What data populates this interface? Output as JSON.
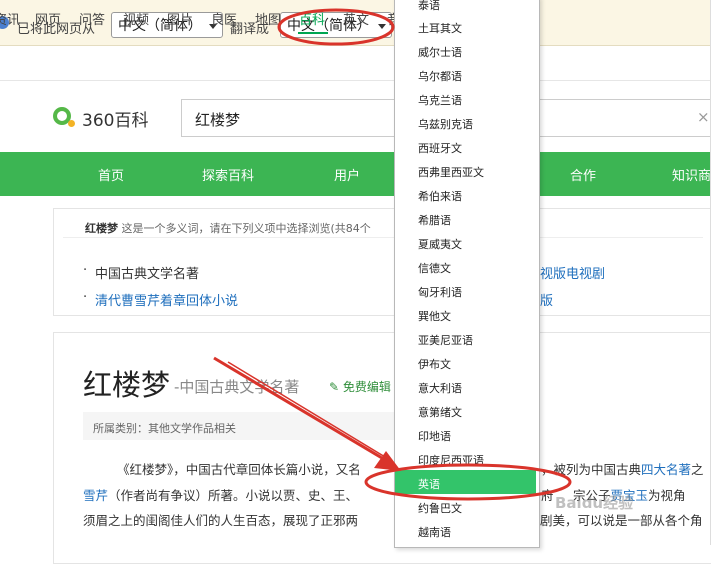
{
  "translate_bar": {
    "prefix": "已将此网页从",
    "from_lang": "中文（简体）",
    "middle": "翻译成",
    "to_lang": "中文（简体）"
  },
  "nav": {
    "items": [
      "资讯",
      "网页",
      "问答",
      "视频",
      "图片",
      "良医",
      "地图",
      "百科",
      "英文",
      "音"
    ],
    "active": "百科"
  },
  "header": {
    "logo": "360百科",
    "search_value": "红楼梦",
    "clear_glyph": "×"
  },
  "menu": {
    "items": [
      "首页",
      "探索百科",
      "用户",
      "合作",
      "知识商"
    ]
  },
  "disambiguation": {
    "term": "红楼梦",
    "note": "这是一个多义词，请在下列义项中选择浏览(共84个",
    "left_options": [
      "中国古典文学名著",
      "清代曹雪芹着章回体小说"
    ],
    "right_options": [
      "视版电视剧",
      "版"
    ]
  },
  "article": {
    "title": "红楼梦",
    "subtitle": "-中国古典文学名著",
    "edit_label": "免费编辑",
    "category_label": "所属类别：",
    "category_value": "其他文学作品相关",
    "line1_a": "《红楼梦》，中国古代章回体长篇小说，又名",
    "line1_b": "，被列为中国古典",
    "line1_link": "四大名著",
    "line1_c": "之",
    "line2_link": "雪芹",
    "line2_a": "（作者尚有争议）所著。小说以贾、史、王、",
    "line2_b": "府",
    "line2_c": "宗",
    "line2_d": "公子",
    "line2_link2": "贾宝玉",
    "line2_e": "为视角",
    "line3_a": "须眉之上的闺阁佳人们的人生百态，展现了正邪两",
    "line3_b": "剧美，可以说是一部从各个角"
  },
  "language_dropdown": {
    "items": [
      "泰语",
      "土耳其文",
      "威尔士语",
      "乌尔都语",
      "乌克兰语",
      "乌兹别克语",
      "西班牙文",
      "西弗里西亚文",
      "希伯来语",
      "希腊语",
      "夏威夷文",
      "信德文",
      "匈牙利语",
      "巽他文",
      "亚美尼亚语",
      "伊布文",
      "意大利语",
      "意第绪文",
      "印地语",
      "印度尼西亚语",
      "英语",
      "约鲁巴文",
      "越南语"
    ],
    "highlighted": "英语"
  },
  "watermark": "Baidu经验",
  "colors": {
    "green": "#3cb553",
    "nav_active": "#00a651",
    "link_blue": "#1f6fbd",
    "highlight": "#33c46a",
    "annotation_red": "#d9342b"
  }
}
